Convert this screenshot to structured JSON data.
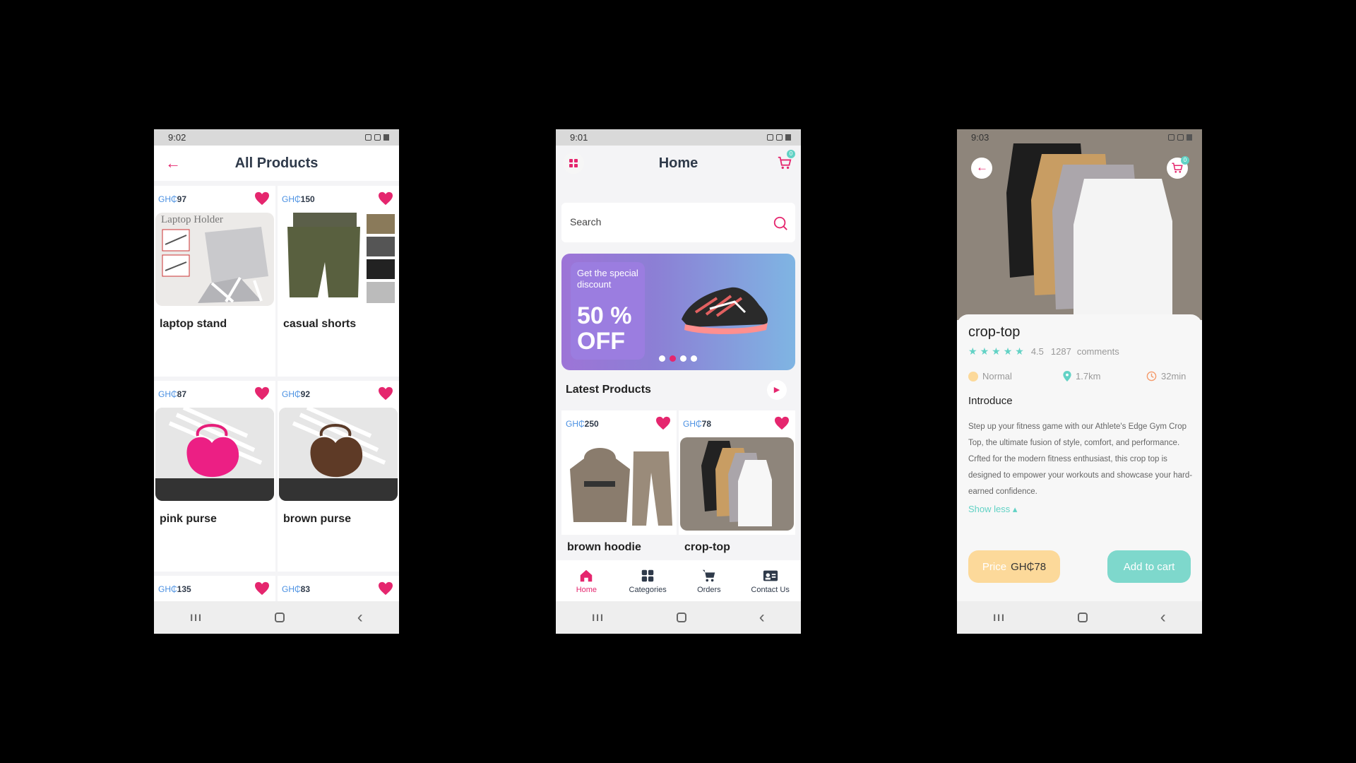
{
  "status": {
    "time_1": "9:02",
    "time_2": "9:01",
    "time_3": "9:03"
  },
  "all_products": {
    "title": "All Products",
    "currency": "GH₵",
    "items": [
      {
        "price": "97",
        "name": "laptop stand"
      },
      {
        "price": "150",
        "name": "casual shorts"
      },
      {
        "price": "87",
        "name": "pink purse"
      },
      {
        "price": "92",
        "name": "brown purse"
      },
      {
        "price": "135",
        "name": ""
      },
      {
        "price": "83",
        "name": ""
      }
    ],
    "laptop_label": "Laptop Holder"
  },
  "home": {
    "title": "Home",
    "cart_count": "0",
    "search_placeholder": "Search",
    "banner": {
      "subtitle": "Get the special discount",
      "big_line1": "50 %",
      "big_line2": "OFF"
    },
    "latest_title": "Latest Products",
    "latest": [
      {
        "price": "250",
        "name": "brown hoodie"
      },
      {
        "price": "78",
        "name": "crop-top"
      }
    ],
    "tabs": [
      "Home",
      "Categories",
      "Orders",
      "Contact Us"
    ]
  },
  "detail": {
    "name": "crop-top",
    "rating": "4.5",
    "comments": "1287",
    "comments_label": "comments",
    "level": "Normal",
    "distance": "1.7km",
    "time": "32min",
    "intro_label": "Introduce",
    "description": "Step up your fitness game with our Athlete's Edge Gym Crop Top, the ultimate fusion of style, comfort, and performance. Crfted for the modern fitness enthusiast, this crop top is designed to empower your workouts and showcase your hard-earned confidence.",
    "show_less": "Show less",
    "price_label": "Price",
    "price_value": "GH₵78",
    "add_to_cart": "Add to cart",
    "cart_count": "0"
  },
  "colors": {
    "accent": "#e5266e",
    "teal": "#62d2c5",
    "price_bg": "#fcd99a"
  }
}
